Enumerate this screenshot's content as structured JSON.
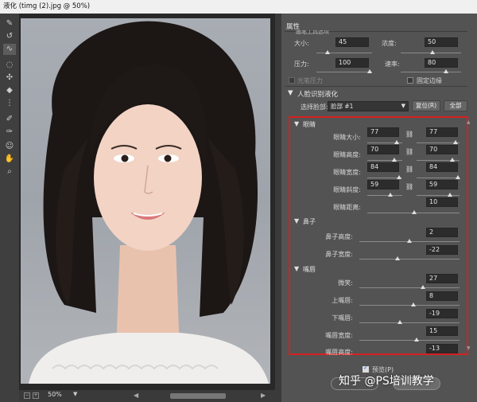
{
  "window": {
    "title": "液化 (timg (2).jpg @ 50%)"
  },
  "toolbar": {
    "tools": [
      {
        "icon": "forward-warp-icon",
        "glyph": "✎"
      },
      {
        "icon": "reconstruct-icon",
        "glyph": "↺"
      },
      {
        "icon": "smooth-icon",
        "glyph": "∿"
      },
      {
        "icon": "twirl-icon",
        "glyph": "◌"
      },
      {
        "icon": "pucker-icon",
        "glyph": "✣"
      },
      {
        "icon": "bloat-icon",
        "glyph": "◆"
      },
      {
        "icon": "push-left-icon",
        "glyph": "⋮"
      },
      {
        "icon": "freeze-mask-icon",
        "glyph": "✐"
      },
      {
        "icon": "thaw-mask-icon",
        "glyph": "✑"
      },
      {
        "icon": "face-tool-icon",
        "glyph": "☺"
      },
      {
        "icon": "hand-icon",
        "glyph": "✋"
      },
      {
        "icon": "zoom-icon",
        "glyph": "⌕"
      }
    ]
  },
  "statusbar": {
    "zoom": "50%"
  },
  "panel": {
    "title": "属性",
    "brush": {
      "truncated_heading": "画笔工具选项",
      "size": {
        "label": "大小:",
        "value": "45"
      },
      "density": {
        "label": "浓度:",
        "value": "50"
      },
      "pressure": {
        "label": "压力:",
        "value": "100"
      },
      "rate": {
        "label": "速率:",
        "value": "80"
      },
      "stylus": {
        "label": "光笔压力"
      },
      "pin_edges": {
        "label": "固定边缘"
      }
    },
    "face_aware": {
      "heading": "人脸识别液化",
      "select_face_label": "选择脸部:",
      "select_face_value": "脸部 #1",
      "reset_label": "复位(R)",
      "all_label": "全部",
      "eyes": {
        "heading": "眼睛",
        "rows": [
          {
            "label": "眼睛大小:",
            "left": "77",
            "right": "77",
            "linked": true
          },
          {
            "label": "眼睛高度:",
            "left": "70",
            "right": "70",
            "linked": true
          },
          {
            "label": "眼睛宽度:",
            "left": "84",
            "right": "84",
            "linked": true
          },
          {
            "label": "眼睛斜度:",
            "left": "59",
            "right": "59",
            "linked": true
          }
        ],
        "distance": {
          "label": "眼睛距离:",
          "value": "10"
        }
      },
      "nose": {
        "heading": "鼻子",
        "rows": [
          {
            "label": "鼻子高度:",
            "value": "2"
          },
          {
            "label": "鼻子宽度:",
            "value": "-22"
          }
        ]
      },
      "mouth": {
        "heading": "嘴唇",
        "rows": [
          {
            "label": "微笑:",
            "value": "27"
          },
          {
            "label": "上嘴唇:",
            "value": "8"
          },
          {
            "label": "下嘴唇:",
            "value": "-19"
          },
          {
            "label": "嘴唇宽度:",
            "value": "15"
          },
          {
            "label": "嘴唇高度:",
            "value": "-13"
          }
        ]
      }
    },
    "preview": {
      "label": "预览(P)"
    }
  },
  "watermark": "知乎 @PS培训教学",
  "colors": {
    "highlight_border": "#d82020",
    "panel_bg": "#535353",
    "canvas_bg": "#282828"
  }
}
